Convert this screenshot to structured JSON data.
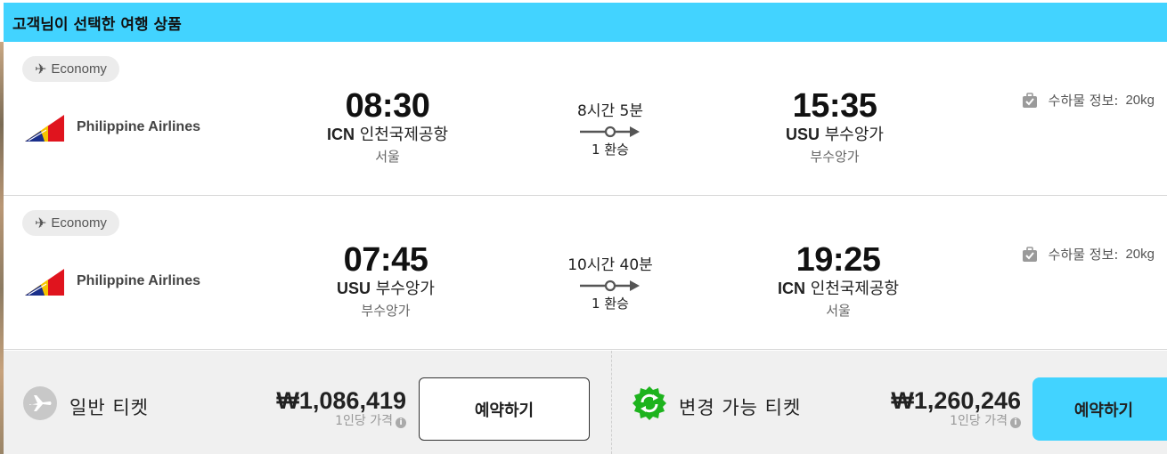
{
  "header": {
    "title": "고객님이 선택한 여행 상품"
  },
  "legs": [
    {
      "cabin": "Economy",
      "airline": "Philippine Airlines",
      "departure": {
        "time": "08:30",
        "code": "ICN",
        "airport": "인천국제공항",
        "city": "서울"
      },
      "duration": "8시간 5분",
      "stops": "1 환승",
      "arrival": {
        "time": "15:35",
        "code": "USU",
        "airport": "부수앙가",
        "city": "부수앙가"
      },
      "baggage": {
        "label": "수하물 정보:",
        "value": "20kg"
      }
    },
    {
      "cabin": "Economy",
      "airline": "Philippine Airlines",
      "departure": {
        "time": "07:45",
        "code": "USU",
        "airport": "부수앙가",
        "city": "부수앙가"
      },
      "duration": "10시간 40분",
      "stops": "1 환승",
      "arrival": {
        "time": "19:25",
        "code": "ICN",
        "airport": "인천국제공항",
        "city": "서울"
      },
      "baggage": {
        "label": "수하물 정보:",
        "value": "20kg"
      }
    }
  ],
  "fares": [
    {
      "name": "일반 티켓",
      "price": "₩1,086,419",
      "per_person": "1인당 가격",
      "button": "예약하기",
      "icon": "plane-circle-icon"
    },
    {
      "name": "변경 가능 티켓",
      "price": "₩1,260,246",
      "per_person": "1인당 가격",
      "button": "예약하기",
      "icon": "refresh-badge-icon"
    }
  ],
  "colors": {
    "accent": "#42d3ff",
    "flex_icon": "#1db31d",
    "airline_red": "#e0141e",
    "airline_yellow": "#f5c400"
  }
}
